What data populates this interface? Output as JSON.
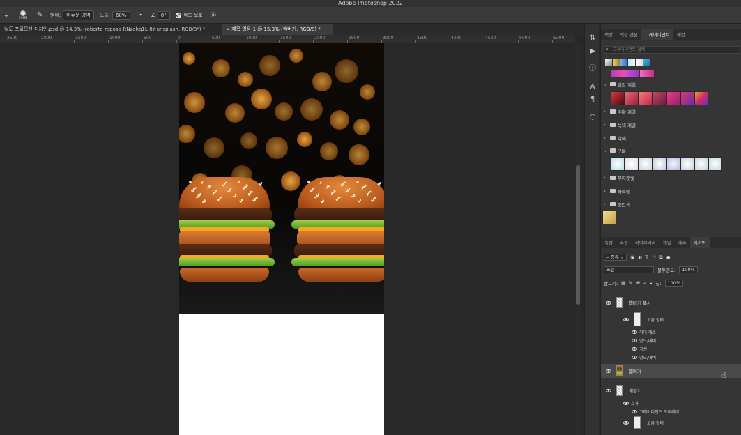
{
  "app": {
    "title": "Adobe Photoshop 2022"
  },
  "options": {
    "brush_size": "1400",
    "range_label": "범위:",
    "range_value": "어두운 영역",
    "exposure_label": "노출:",
    "exposure_value": "60%",
    "angle_value": "0°",
    "protect_tone_label": "색조 보호"
  },
  "doc_tabs": [
    {
      "label": "닐도 프로모션 디자인.psd @ 14.3% (roberto-reposo-RNzehq1L-8Y-unsplash, RGB/8*) *",
      "active": false
    },
    {
      "label": "제목 없음-1 @ 15.3% (햄버거, RGB/8) *",
      "active": true
    }
  ],
  "ruler": {
    "labels": [
      "2500",
      "2000",
      "1500",
      "1000",
      "500",
      "0",
      "500",
      "1000",
      "1500",
      "2000",
      "2500",
      "3000",
      "3500",
      "4000",
      "4500",
      "5000",
      "5300"
    ]
  },
  "panel_top": {
    "tabs": [
      "색상",
      "색상 견본",
      "그레이디언트",
      "패턴"
    ],
    "active_tab": "그레이디언트",
    "search_placeholder": "그레이디언트 검색",
    "groups": [
      {
        "label": "빨강 계열",
        "open": true
      },
      {
        "label": "주황 계열",
        "open": false
      },
      {
        "label": "녹색 계열",
        "open": false
      },
      {
        "label": "회색",
        "open": false
      },
      {
        "label": "구름",
        "open": true
      },
      {
        "label": "무지갯빛",
        "open": false
      },
      {
        "label": "파스텔",
        "open": false
      },
      {
        "label": "중간색",
        "open": false
      }
    ]
  },
  "panel_layers": {
    "tabs": [
      "속성",
      "조정",
      "라이브러리",
      "채널",
      "패스",
      "레이어"
    ],
    "active_tab": "레이어",
    "filter_kind": "종류",
    "blend_mode": "표준",
    "opacity_label": "불투명도:",
    "opacity_value": "100%",
    "lock_label": "잠그기:",
    "fill_label": "칠:",
    "fill_value": "100%",
    "layers": [
      {
        "name": "햄버거 복사"
      },
      {
        "name": "햄버거"
      },
      {
        "name": "배경2"
      }
    ],
    "sub_items": {
      "smart_filter_1": "고급 필터",
      "high_pass": "하이 패스",
      "brightness_1": "명도/대비",
      "curves": "곡선",
      "brightness_2": "명도/대비",
      "effects": "효과",
      "gradient_overlay": "그레이디언트 오버레이",
      "smart_filter_2": "고급 필터"
    }
  },
  "colors": {
    "accent": "#3d3d3d",
    "panel_bg": "#353535"
  }
}
